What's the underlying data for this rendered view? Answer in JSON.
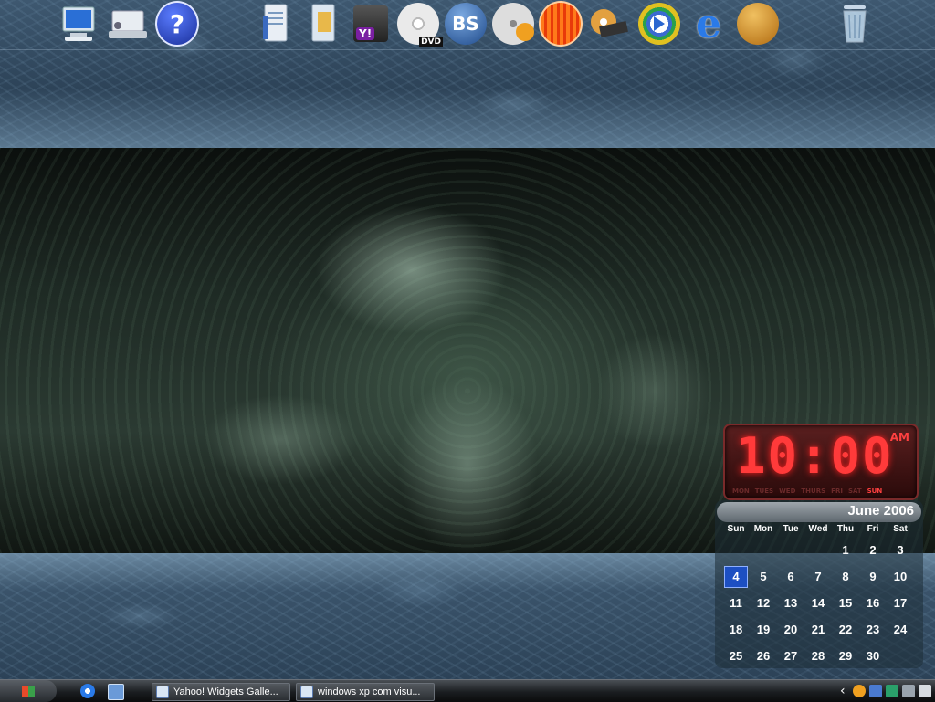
{
  "dock": {
    "icons": [
      {
        "name": "my-computer-icon"
      },
      {
        "name": "network-icon"
      },
      {
        "name": "help-icon",
        "glyph": "?"
      },
      {
        "name": "documents-icon"
      },
      {
        "name": "folder-icon"
      },
      {
        "name": "yahoo-widgets-icon",
        "glyph": "Y!"
      },
      {
        "name": "dvd-player-icon",
        "label": "DVD"
      },
      {
        "name": "bsplayer-icon",
        "glyph": "BS"
      },
      {
        "name": "media-player-cd-icon"
      },
      {
        "name": "opera-icon"
      },
      {
        "name": "movie-maker-icon"
      },
      {
        "name": "windows-media-player-icon"
      },
      {
        "name": "internet-explorer-icon",
        "glyph": "e"
      },
      {
        "name": "games-dice-icon"
      },
      {
        "name": "recycle-bin-icon"
      }
    ]
  },
  "clock": {
    "time": "10:00",
    "ampm": "AM",
    "days": [
      "MON",
      "TUES",
      "WED",
      "THURS",
      "FRI",
      "SAT",
      "SUN"
    ],
    "active_day": "SUN"
  },
  "calendar": {
    "title": "June 2006",
    "weekdays": [
      "Sun",
      "Mon",
      "Tue",
      "Wed",
      "Thu",
      "Fri",
      "Sat"
    ],
    "weeks": [
      [
        "",
        "",
        "",
        "",
        "1",
        "2",
        "3"
      ],
      [
        "4",
        "5",
        "6",
        "7",
        "8",
        "9",
        "10"
      ],
      [
        "11",
        "12",
        "13",
        "14",
        "15",
        "16",
        "17"
      ],
      [
        "18",
        "19",
        "20",
        "21",
        "22",
        "23",
        "24"
      ],
      [
        "25",
        "26",
        "27",
        "28",
        "29",
        "30",
        ""
      ]
    ],
    "today": "4"
  },
  "taskbar": {
    "tasks": [
      {
        "label": "Yahoo! Widgets Galle..."
      },
      {
        "label": "windows xp com visu..."
      }
    ],
    "tray_chevron": "‹"
  }
}
